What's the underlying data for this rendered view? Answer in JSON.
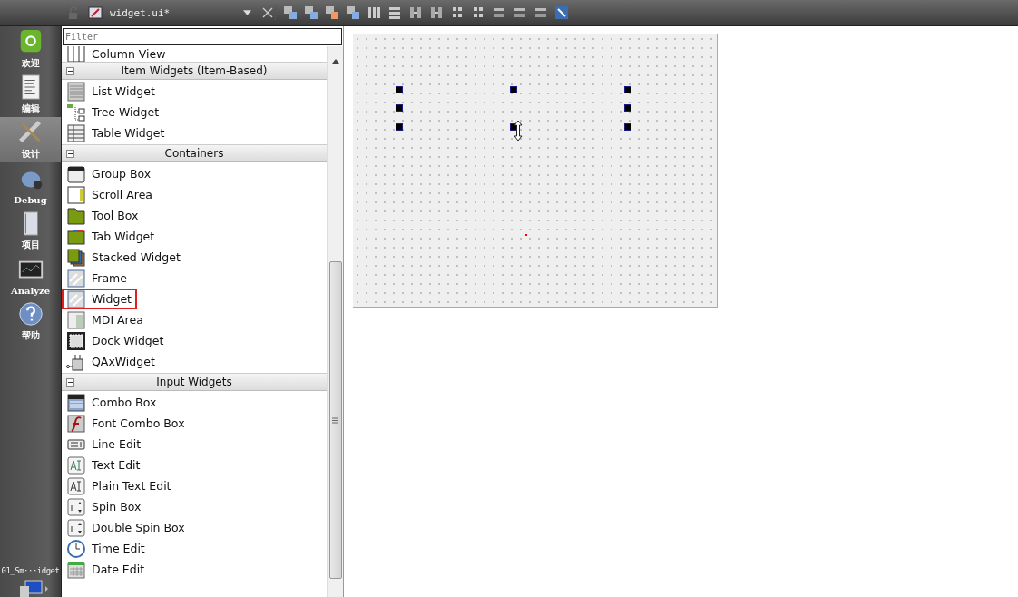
{
  "toolbar": {
    "file_name": "widget.ui*"
  },
  "modes": [
    {
      "label": "欢迎",
      "selected": false
    },
    {
      "label": "编辑",
      "selected": false
    },
    {
      "label": "设计",
      "selected": true
    },
    {
      "label": "Debug",
      "selected": false
    },
    {
      "label": "项目",
      "selected": false
    },
    {
      "label": "Analyze",
      "selected": false
    },
    {
      "label": "帮助",
      "selected": false
    }
  ],
  "project": {
    "label": "01_Sm···idget"
  },
  "widget_box": {
    "filter": {
      "placeholder": "Filter"
    },
    "rows": [
      {
        "kind": "item",
        "label": "Column View",
        "highlighted": false
      },
      {
        "kind": "category",
        "label": "Item Widgets (Item-Based)",
        "expanded": true
      },
      {
        "kind": "item",
        "label": "List Widget",
        "highlighted": false
      },
      {
        "kind": "item",
        "label": "Tree Widget",
        "highlighted": false
      },
      {
        "kind": "item",
        "label": "Table Widget",
        "highlighted": false
      },
      {
        "kind": "category",
        "label": "Containers",
        "expanded": true
      },
      {
        "kind": "item",
        "label": "Group Box",
        "highlighted": false
      },
      {
        "kind": "item",
        "label": "Scroll Area",
        "highlighted": false
      },
      {
        "kind": "item",
        "label": "Tool Box",
        "highlighted": false
      },
      {
        "kind": "item",
        "label": "Tab Widget",
        "highlighted": false
      },
      {
        "kind": "item",
        "label": "Stacked Widget",
        "highlighted": false
      },
      {
        "kind": "item",
        "label": "Frame",
        "highlighted": false
      },
      {
        "kind": "item",
        "label": "Widget",
        "highlighted": true
      },
      {
        "kind": "item",
        "label": "MDI Area",
        "highlighted": false
      },
      {
        "kind": "item",
        "label": "Dock Widget",
        "highlighted": false
      },
      {
        "kind": "item",
        "label": "QAxWidget",
        "highlighted": false
      },
      {
        "kind": "category",
        "label": "Input Widgets",
        "expanded": true
      },
      {
        "kind": "item",
        "label": "Combo Box",
        "highlighted": false
      },
      {
        "kind": "item",
        "label": "Font Combo Box",
        "highlighted": false
      },
      {
        "kind": "item",
        "label": "Line Edit",
        "highlighted": false
      },
      {
        "kind": "item",
        "label": "Text Edit",
        "highlighted": false
      },
      {
        "kind": "item",
        "label": "Plain Text Edit",
        "highlighted": false
      },
      {
        "kind": "item",
        "label": "Spin Box",
        "highlighted": false
      },
      {
        "kind": "item",
        "label": "Double Spin Box",
        "highlighted": false
      },
      {
        "kind": "item",
        "label": "Time Edit",
        "highlighted": false
      },
      {
        "kind": "item",
        "label": "Date Edit",
        "highlighted": false
      }
    ]
  },
  "form": {
    "widget_selected": true
  }
}
